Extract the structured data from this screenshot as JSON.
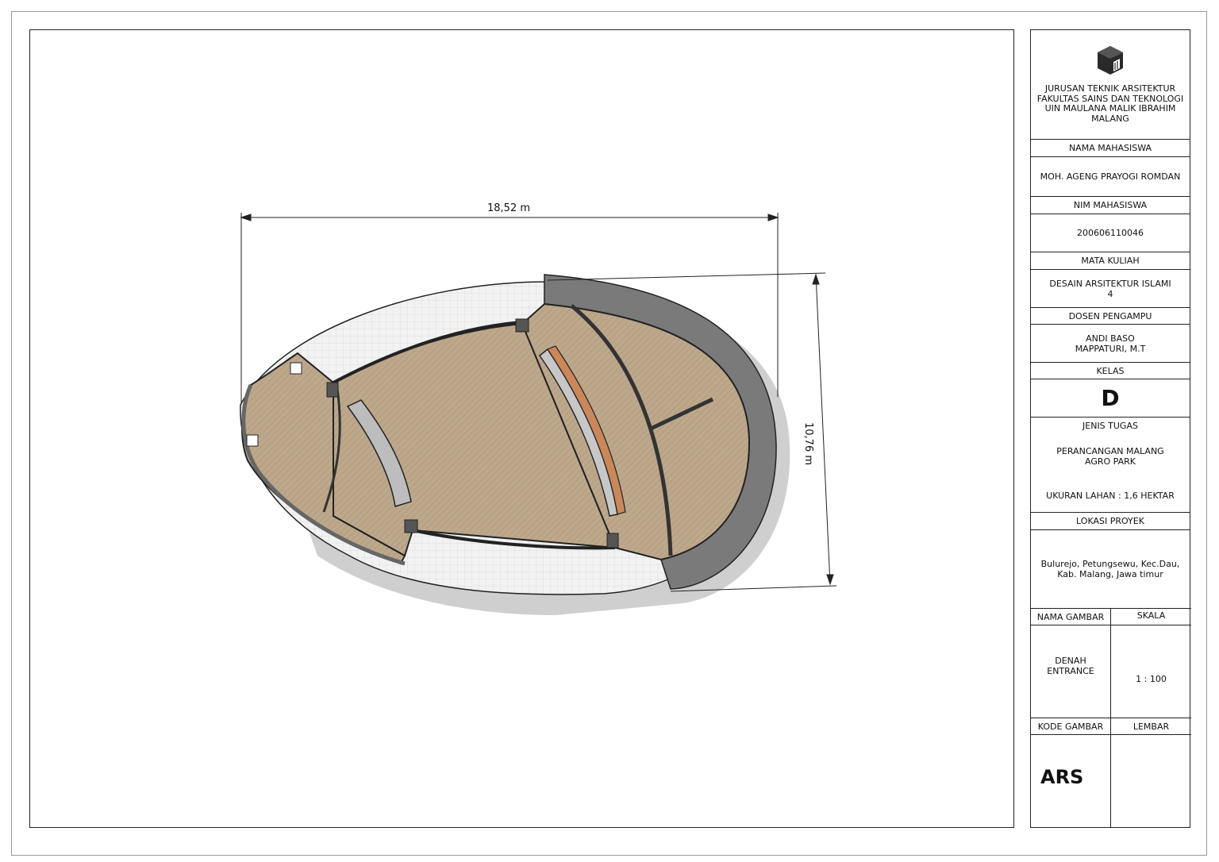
{
  "plan": {
    "dimension_width": "18,52 m",
    "dimension_height": "10,76 m",
    "colors": {
      "floor": "#bda88c",
      "paving": "#eeeeee",
      "wall": "#7a7a7a",
      "shadow": "#cfcfcf",
      "accent_bench": "#c9875a",
      "outline": "#222222"
    }
  },
  "title_block": {
    "logo_icon": "cube-logo-icon",
    "institution": "JURUSAN TEKNIK ARSITEKTUR\nFAKULTAS SAINS DAN TEKNOLOGI\nUIN MAULANA MALIK IBRAHIM\nMALANG",
    "student_name_label": "NAMA MAHASISWA",
    "student_name": "MOH. AGENG PRAYOGI ROMDAN",
    "nim_label": "NIM MAHASISWA",
    "nim": "200606110046",
    "course_label": "MATA KULIAH",
    "course": "DESAIN ARSITEKTUR ISLAMI\n4",
    "lecturer_label": "DOSEN PENGAMPU",
    "lecturer": "ANDI BASO\nMAPPATURI, M.T",
    "class_label": "KELAS",
    "class_value": "D",
    "task_label": "JENIS TUGAS",
    "task": "PERANCANGAN MALANG\nAGRO PARK",
    "land_size": "UKURAN LAHAN : 1,6 HEKTAR",
    "location_label": "LOKASI PROYEK",
    "location": "Bulurejo, Petungsewu, Kec.Dau,\nKab. Malang, Jawa timur",
    "drawing_name_label": "NAMA GAMBAR",
    "scale_label": "SKALA",
    "drawing_name": "DENAH ENTRANCE",
    "scale": "1 : 100",
    "drawing_code_label": "KODE GAMBAR",
    "sheet_label": "LEMBAR",
    "drawing_code": "ARS",
    "sheet": ""
  }
}
